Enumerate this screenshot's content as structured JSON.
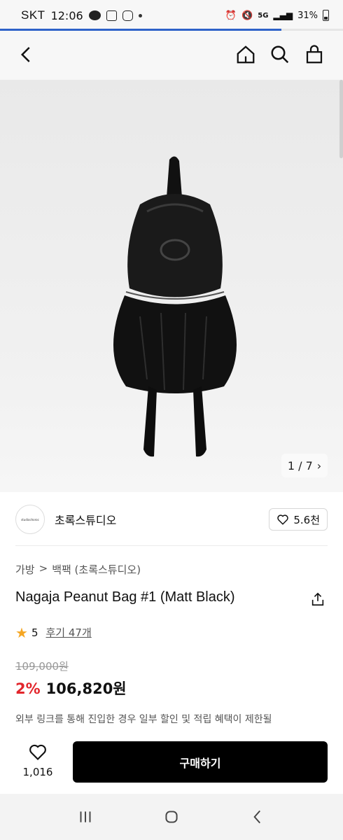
{
  "status_bar": {
    "carrier": "SKT",
    "time": "12:06",
    "network": "5G",
    "battery": "31%",
    "icons": [
      "talk-icon",
      "gallery-icon",
      "instagram-icon",
      "notification-dot-icon",
      "alarm-icon",
      "mute-icon",
      "signal-icon",
      "battery-icon"
    ]
  },
  "page_progress": 0.82,
  "nav": {
    "icons": [
      "back-icon",
      "home-icon",
      "search-icon",
      "cart-icon"
    ]
  },
  "gallery": {
    "counter_text": "1 / 7",
    "counter_chevron": "›"
  },
  "brand": {
    "logo_text": "studiochoroc",
    "name": "초록스튜디오",
    "like_count": "5.6천"
  },
  "breadcrumb": {
    "items": [
      "가방",
      "백팩 (초록스튜디오)"
    ],
    "separator": ">"
  },
  "product": {
    "title": "Nagaja Peanut Bag #1 (Matt Black)",
    "rating": "5",
    "review_label": "후기 47개",
    "original_price": "109,000원",
    "discount": "2%",
    "price": "106,820원",
    "notice": "외부 링크를 통해 진입한 경우 일부 할인 및 적립 혜택이 제한될"
  },
  "action_bar": {
    "wish_count": "1,016",
    "buy_label": "구매하기"
  },
  "colors": {
    "accent_blue": "#2f63c9",
    "discount_red": "#e2252b",
    "star": "#f5a623",
    "buy_button": "#000000"
  }
}
